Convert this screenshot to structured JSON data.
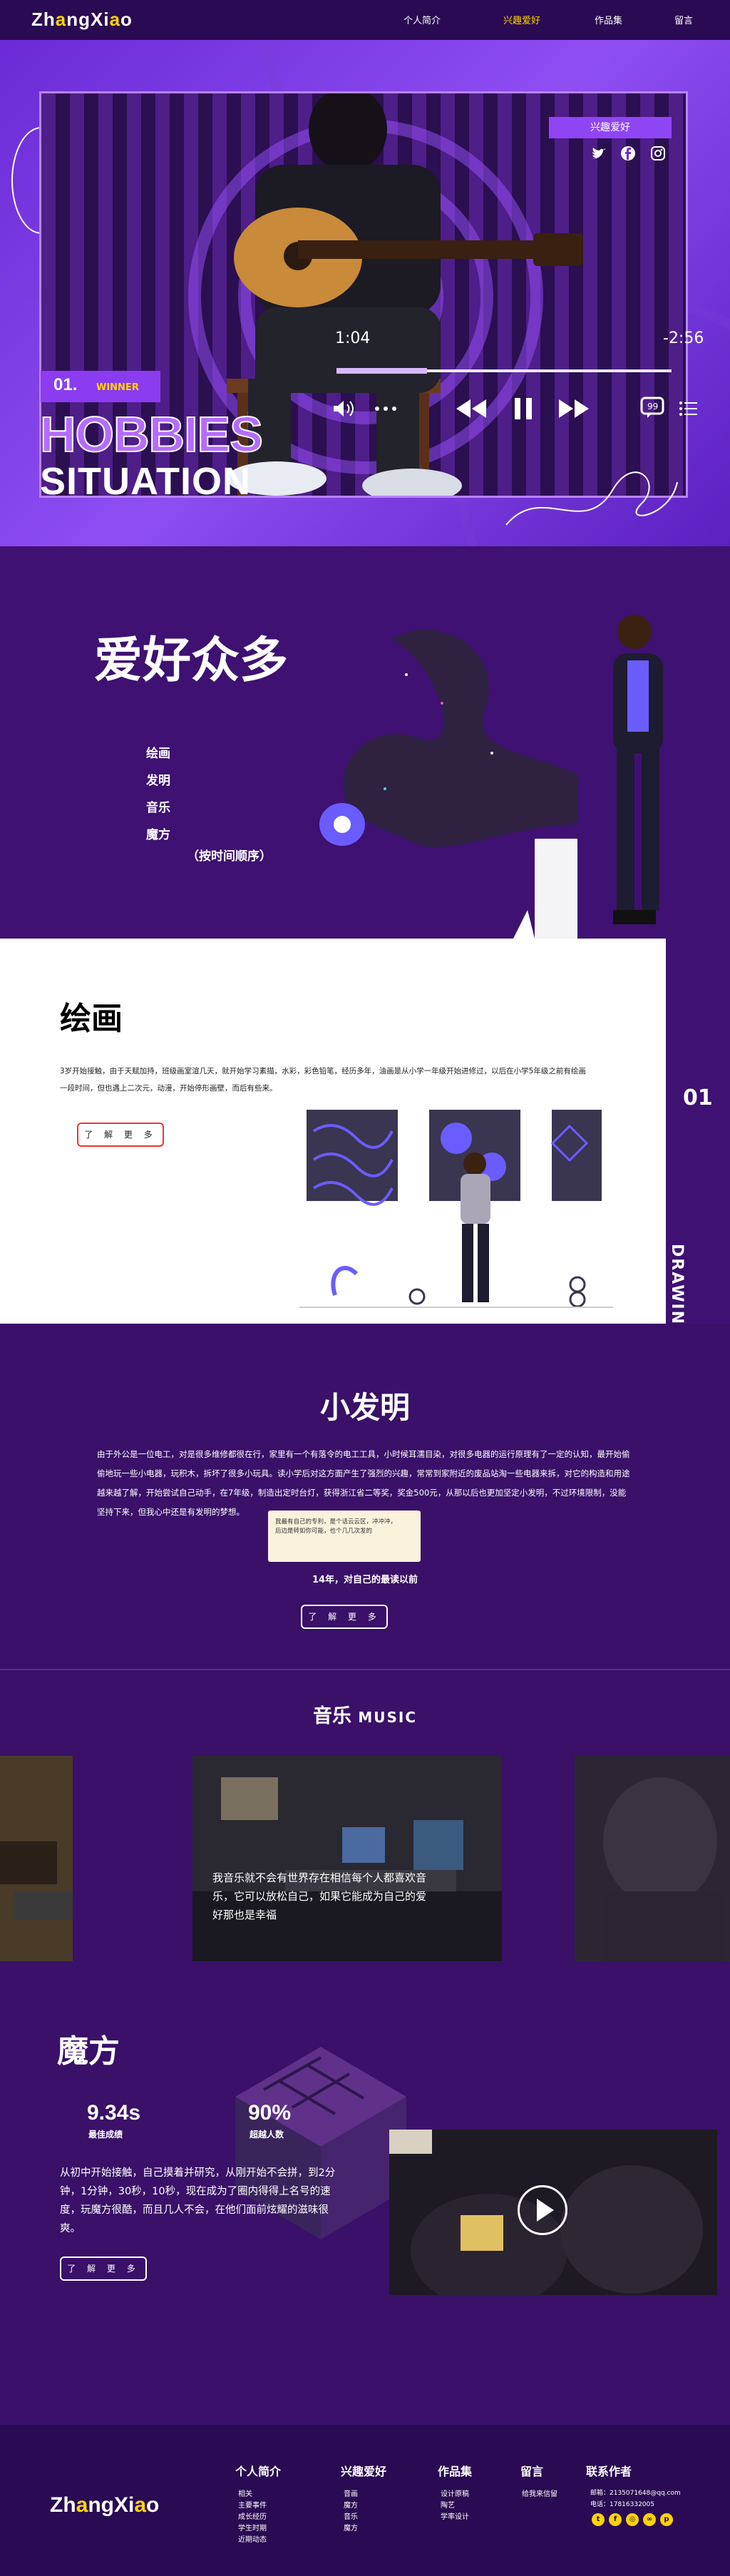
{
  "nav": {
    "logo": {
      "part1": "Zh",
      "part2": "a",
      "part3": "ngXi",
      "part4": "a",
      "part5": "o"
    },
    "items": [
      "个人简介",
      "兴趣爱好",
      "作品集",
      "留言"
    ]
  },
  "hero": {
    "tag": "兴趣爱好",
    "badge_num": "01.",
    "badge_label": "WINNER",
    "title_line1": "HOBBIES",
    "title_line2": "SITUATION",
    "time_start": "1:04",
    "time_end": "-2:56",
    "progress": 0.27,
    "icons": [
      "twitter-icon",
      "facebook-icon",
      "instagram-icon",
      "volume-icon",
      "rewind-icon",
      "pause-icon",
      "forward-icon",
      "comment-icon",
      "menu-icon"
    ],
    "colors": {
      "bg": "#7a38e0",
      "frame": "#2b0f50",
      "accent": "#9045f5",
      "yellow": "#ffd400"
    }
  },
  "hobbies": {
    "title": "爱好众多",
    "items": [
      "绘画",
      "发明",
      "音乐",
      "魔方"
    ],
    "note": "（按时间顺序）"
  },
  "painting": {
    "title": "绘画",
    "text": "3岁开始接触，由于天赋加持，班级画室渲几天，就开始学习素描，水彩，彩色铅笔，经历多年，油画是从小学一年级开始进修过，以后在小学5年级之前有绘画一段时间，但也遇上二次元，动漫，开始停形画壁，而后有些来。",
    "button": "了 解 更 多",
    "side_num": "01",
    "side_word": "DRAWING"
  },
  "invention": {
    "title": "小发明",
    "text": "由于外公是一位电工，对是很多维修都很在行，家里有一个有落令的电工工具，小时候耳濡目染，对很多电器的运行原理有了一定的认知，最开始偷偷地玩一些小电器，玩积木，拆坏了很多小玩具。读小学后对这方面产生了强烈的兴趣，常常到家附近的废品站淘一些电器来拆，对它的构造和用途越来越了解，开始尝试自己动手，在7年级，制造出定时台灯，获得浙江省二等奖，奖金500元，从那以后也更加坚定小发明，不过环境限制，没能坚持下来，但我心中还是有发明的梦想。",
    "card_text": "我最有自己的专利，是个话云云区，冲冲冲，后边是转如你可能，也个几几次发的",
    "caption": "14年，对自己的最读以前",
    "button": "了 解 更 多"
  },
  "music": {
    "title": "音乐",
    "title_en": "MUSIC",
    "caption": "我音乐就不会有世界存在相信每个人都喜欢音乐，它可以放松自己，如果它能成为自己的爱好那也是幸福"
  },
  "cube": {
    "title": "魔方",
    "stats": [
      {
        "value": "9.34s",
        "label": "最佳成绩"
      },
      {
        "value": "90%",
        "label": "超越人数"
      }
    ],
    "text": "从初中开始接触，自己摸着并研究，从刚开始不会拼，到2分钟，1分钟，30秒，10秒，现在成为了圈内得得上名号的速度，玩魔方很酷，而且几人不会，在他们面前炫耀的滋味很爽。",
    "button": "了 解 更 多",
    "video_label": "video-player"
  },
  "footer": {
    "logo": {
      "part1": "Zh",
      "part2": "a",
      "part3": "ngXi",
      "part4": "a",
      "part5": "o"
    },
    "columns": [
      {
        "head": "个人简介",
        "links": [
          "相关",
          "主要事件",
          "成长经历",
          "学生时期",
          "近期动态"
        ]
      },
      {
        "head": "兴趣爱好",
        "links": [
          "音画",
          "魔方",
          "音乐",
          "魔方"
        ]
      },
      {
        "head": "作品集",
        "links": [
          "设计原稿",
          "陶艺",
          "学率设计"
        ]
      },
      {
        "head": "留言",
        "links": [
          "给我来信留"
        ]
      },
      {
        "head": "联系作者",
        "links": [
          "邮箱：2135071648@qq.com",
          "电话：17816332005"
        ]
      }
    ]
  }
}
